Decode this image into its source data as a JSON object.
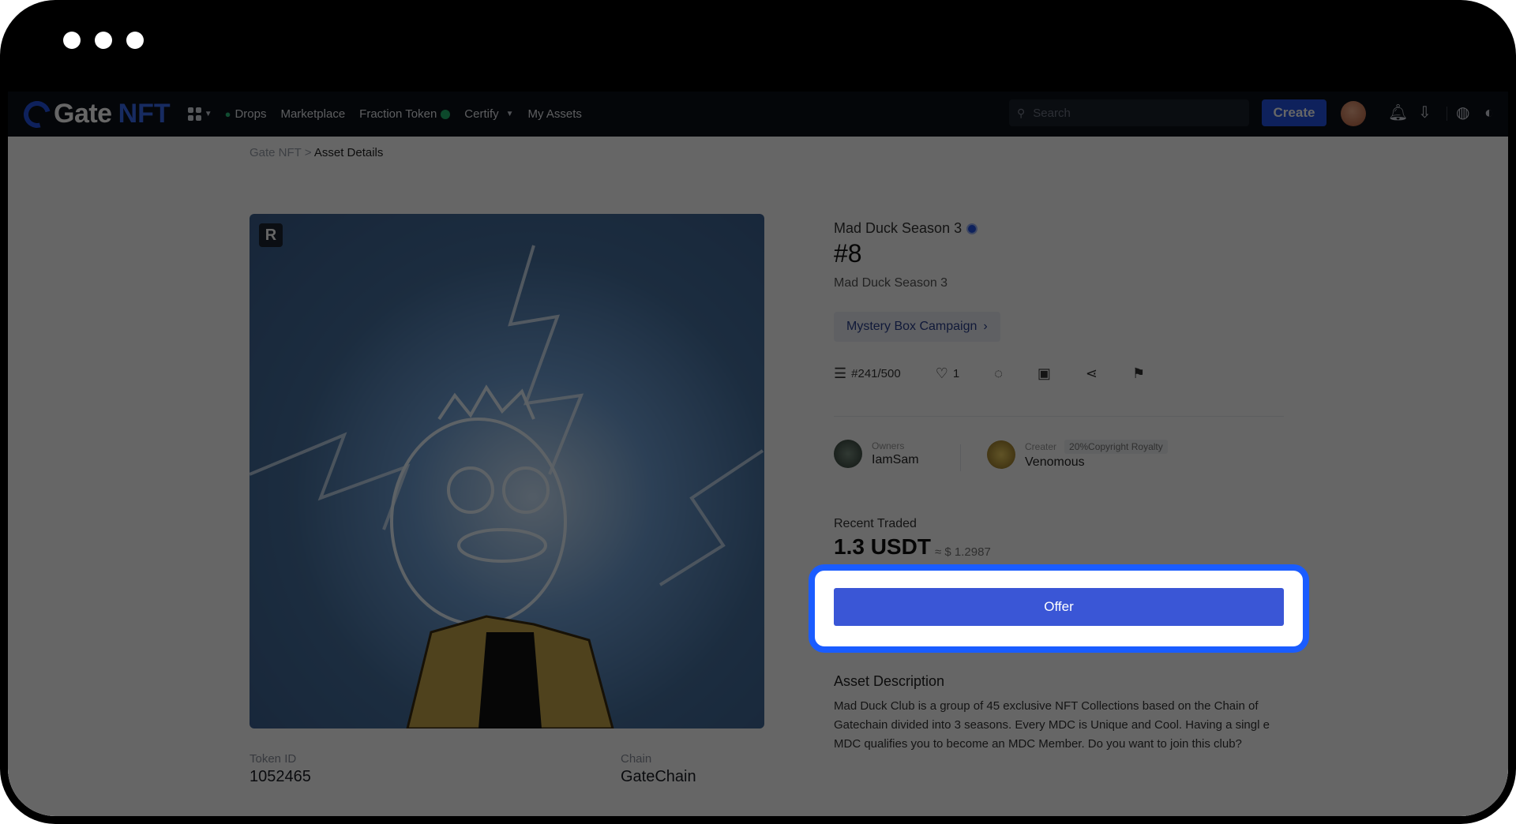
{
  "nav": {
    "logo_gate": "Gate",
    "logo_nft": "NFT",
    "links": [
      "Drops",
      "Marketplace",
      "Fraction Token",
      "Certify",
      "My Assets"
    ],
    "search_placeholder": "Search",
    "create_label": "Create"
  },
  "breadcrumb": {
    "root": "Gate NFT",
    "sep": ">",
    "current": "Asset Details"
  },
  "art": {
    "badge": "R"
  },
  "token": {
    "collection": "Mad Duck Season 3",
    "name": "#8",
    "subtitle": "Mad Duck Season 3",
    "campaign_label": "Mystery Box Campaign",
    "edition": "#241/500",
    "likes": "1"
  },
  "owner": {
    "role": "Owners",
    "name": "IamSam"
  },
  "creator": {
    "role": "Creater",
    "royalty": "20%Copyright Royalty",
    "name": "Venomous"
  },
  "trade": {
    "label": "Recent Traded",
    "price": "1.3 USDT",
    "usd": "≈ $ 1.2987"
  },
  "offer_label": "Offer",
  "description": {
    "title": "Asset Description",
    "text": "Mad Duck Club is a group of 45 exclusive NFT Collections based on the Chain of Gatechain divided into 3 seasons. Every MDC is Unique and Cool. Having a singl e MDC qualifies you to become an MDC Member. Do you want to join this club?"
  },
  "details": {
    "token_id_label": "Token ID",
    "token_id": "1052465",
    "chain_label": "Chain",
    "chain": "GateChain"
  },
  "colors": {
    "accent": "#2354e6",
    "highlight": "#1a5cff",
    "offer": "#3a56d6"
  }
}
